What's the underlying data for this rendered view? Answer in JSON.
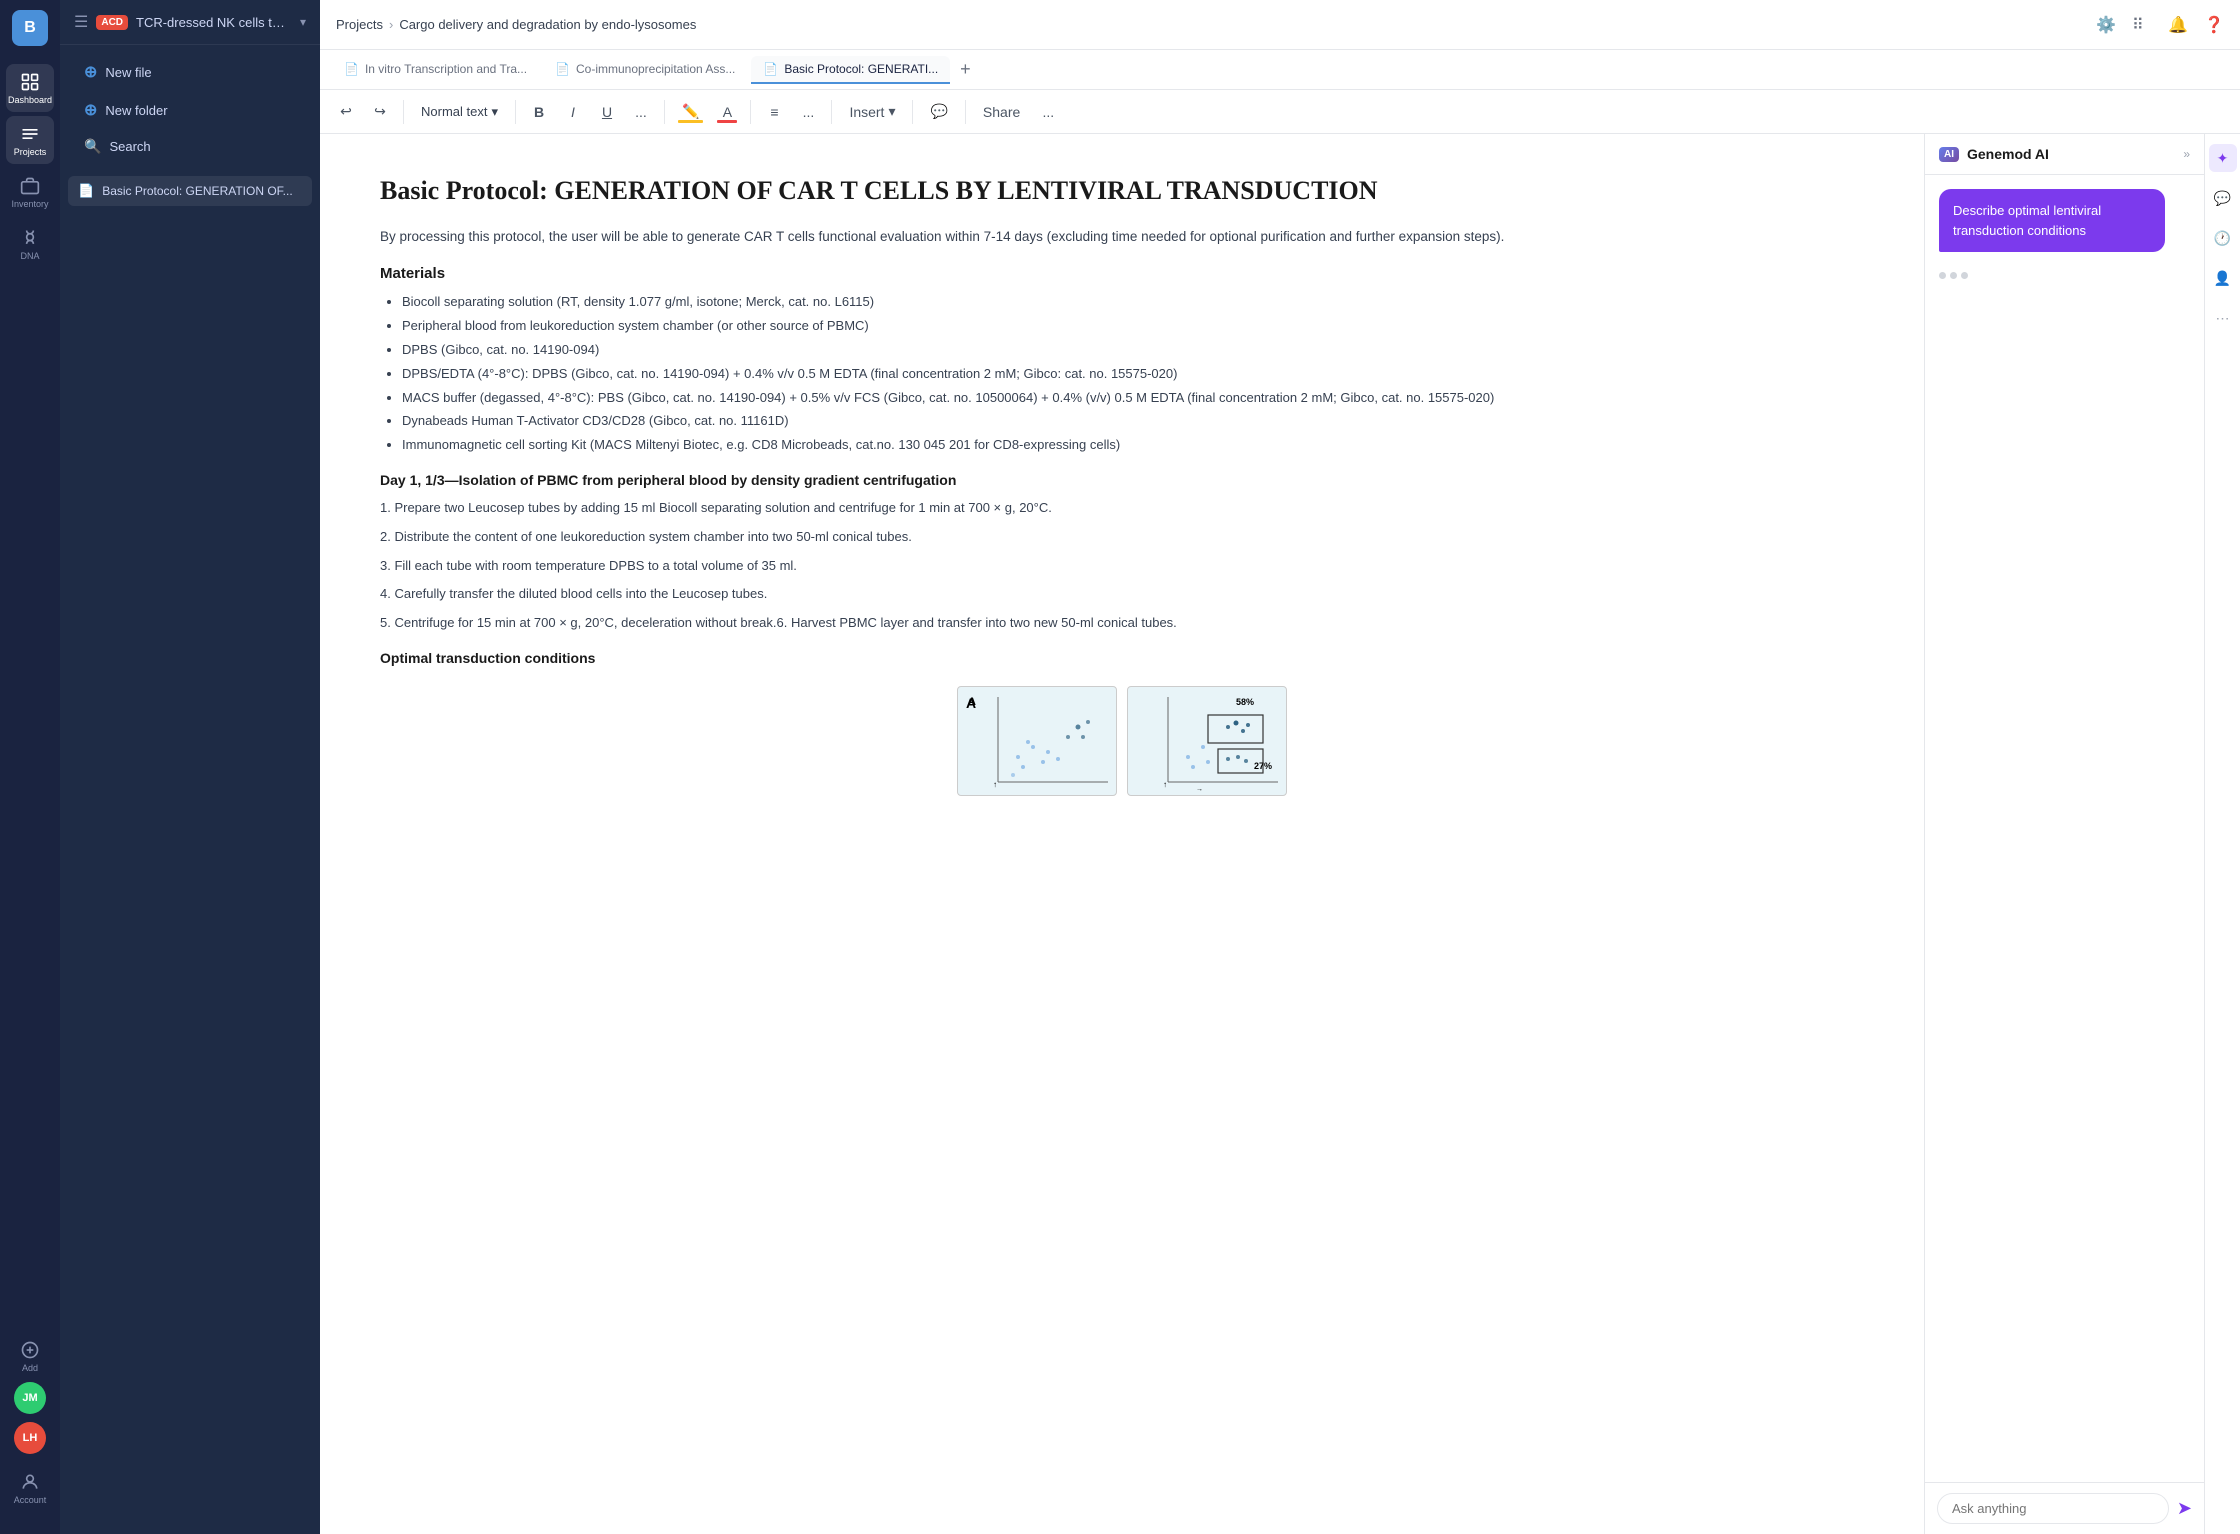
{
  "app": {
    "logo_text": "B"
  },
  "nav": {
    "items": [
      {
        "id": "dashboard",
        "label": "Dashboard",
        "active": false
      },
      {
        "id": "projects",
        "label": "Projects",
        "active": true
      },
      {
        "id": "inventory",
        "label": "Inventory",
        "active": false
      },
      {
        "id": "dna",
        "label": "DNA",
        "active": false
      },
      {
        "id": "add",
        "label": "Add",
        "active": false
      }
    ],
    "account_label": "Account"
  },
  "breadcrumb": {
    "projects": "Projects",
    "separator": "›",
    "current": "Cargo delivery and degradation by endo-lysosomes"
  },
  "file_panel": {
    "badge": "ACD",
    "project_name": "TCR-dressed NK cells to k...",
    "new_file": "New file",
    "new_folder": "New folder",
    "search": "Search",
    "files": [
      {
        "name": "Basic Protocol: GENERATION OF..."
      }
    ]
  },
  "tabs": [
    {
      "label": "In vitro Transcription and Tra...",
      "active": false
    },
    {
      "label": "Co-immunoprecipitation Ass...",
      "active": false
    },
    {
      "label": "Basic Protocol: GENERATI...",
      "active": true
    }
  ],
  "toolbar": {
    "undo": "↩",
    "redo": "↪",
    "text_style": "Normal text",
    "bold": "B",
    "italic": "I",
    "underline": "U",
    "more_format": "...",
    "highlight": "A",
    "text_color": "A",
    "align": "≡",
    "more_align": "...",
    "insert": "Insert",
    "insert_arrow": "▾",
    "comment": "💬",
    "share": "Share",
    "more": "..."
  },
  "document": {
    "title": "Basic Protocol: GENERATION OF CAR T CELLS BY LENTIVIRAL TRANSDUCTION",
    "intro": "By processing this protocol, the user will be able to generate CAR T cells functional evaluation within 7-14 days (excluding time needed for optional purification and further expansion steps).",
    "materials_heading": "Materials",
    "materials": [
      "Biocoll separating solution (RT, density 1.077 g/ml, isotone; Merck, cat. no. L6115)",
      "Peripheral blood from leukoreduction system chamber (or other source of PBMC)",
      "DPBS (Gibco, cat. no. 14190-094)",
      "DPBS/EDTA (4°-8°C): DPBS (Gibco, cat. no. 14190-094) + 0.4% v/v 0.5 M EDTA (final concentration 2 mM; Gibco: cat. no. 15575-020)",
      "MACS buffer (degassed, 4°-8°C): PBS (Gibco, cat. no. 14190-094) + 0.5% v/v FCS (Gibco, cat. no. 10500064) + 0.4% (v/v) 0.5 M EDTA (final concentration 2 mM; Gibco, cat. no. 15575-020)",
      "Dynabeads Human T-Activator CD3/CD28 (Gibco, cat. no. 11161D)",
      "Immunomagnetic cell sorting Kit (MACS Miltenyi Biotec, e.g. CD8 Microbeads, cat.no. 130 045 201 for CD8-expressing cells)"
    ],
    "day1_heading": "Day 1, 1/3—Isolation of PBMC from peripheral blood by density gradient centrifugation",
    "steps": [
      "1. Prepare two Leucosep tubes by adding 15 ml Biocoll separating solution and centrifuge for 1 min at 700 × g, 20°C.",
      "2. Distribute the content of one leukoreduction system chamber into two 50-ml conical tubes.",
      "3. Fill each tube with room temperature DPBS to a total volume of 35 ml.",
      "4. Carefully transfer the diluted blood cells into the Leucosep tubes.",
      "5. Centrifuge for 15 min at 700 × g, 20°C, deceleration without break.6. Harvest PBMC layer and transfer into two new 50-ml conical tubes."
    ],
    "optimal_heading": "Optimal transduction conditions",
    "figure_label": "A",
    "figure_pct1": "58%",
    "figure_pct2": "27%"
  },
  "ai_panel": {
    "badge": "AI",
    "title": "Genemod AI",
    "message": "Describe optimal lentiviral transduction conditions",
    "input_placeholder": "Ask anything",
    "send_icon": "➤"
  },
  "avatars": [
    {
      "initials": "JM",
      "color": "#2ecc71"
    },
    {
      "initials": "LH",
      "color": "#e74c3c"
    }
  ]
}
